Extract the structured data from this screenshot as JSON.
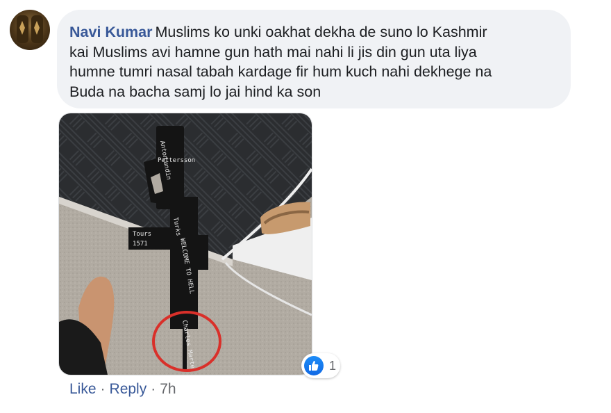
{
  "comment": {
    "author": "Navi Kumar",
    "lines": [
      "Muslims ko unki oakhat dekha de suno lo Kashmir",
      "kai Muslims avi hamne gun hath mai nahi li jis din gun uta liya",
      "humne tumri nasal tabah kardage fir hum kuch nahi dekhege na",
      "Buda na bacha samj lo jai hind ka son"
    ]
  },
  "photo": {
    "gun_text": [
      "Anton",
      "Lundin",
      "Pettersson",
      "Tours",
      "1571",
      "Turks",
      "WELCOME TO HELL",
      "Charles Martel"
    ]
  },
  "reactions": {
    "icon": "like-icon",
    "count": "1",
    "like_color": "#1877f2"
  },
  "actions": {
    "like_label": "Like",
    "separator": "·",
    "reply_label": "Reply",
    "time": "7h"
  }
}
